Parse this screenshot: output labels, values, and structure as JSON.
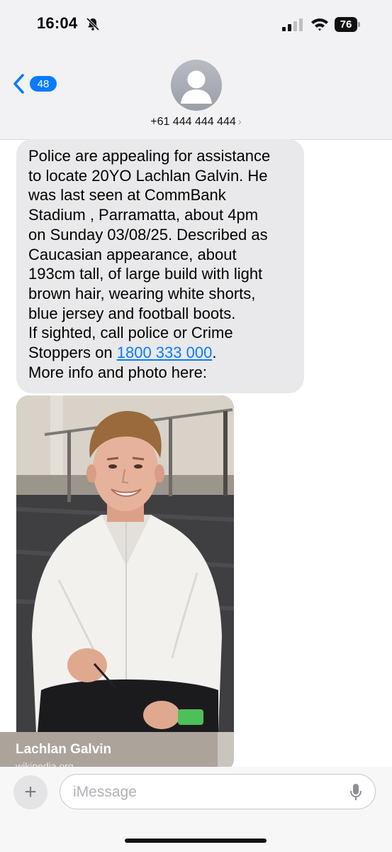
{
  "status_bar": {
    "time": "16:04",
    "battery": "76",
    "icons": [
      "bell-slash-icon",
      "cellular-signal-icon",
      "wifi-icon",
      "battery-icon"
    ]
  },
  "header": {
    "back_badge": "48",
    "contact_number": "+61 444 444 444",
    "contact_chevron": "›"
  },
  "message": {
    "text_lines": [
      "Police are appealing for assistance",
      "to locate 20YO Lachlan Galvin. He",
      "was last seen at CommBank",
      "Stadium , Parramatta, about 4pm",
      "on Sunday 03/08/25. Described as",
      "Caucasian appearance, about",
      "193cm tall, of large build with light",
      "brown hair, wearing white shorts,",
      "blue jersey and football boots.",
      "If sighted, call police or Crime"
    ],
    "phone_prefix": "Stoppers on ",
    "phone_link": "1800 333 000",
    "phone_suffix": ".",
    "last_line": "More info and photo here:"
  },
  "link_preview": {
    "title": "Lachlan Galvin",
    "source": "wikipedia.org"
  },
  "composer": {
    "plus_label": "+",
    "placeholder": "iMessage"
  },
  "colors": {
    "accent": "#0a7aff",
    "bubble": "#e9e9eb",
    "header_bg": "#f2f2f4"
  }
}
